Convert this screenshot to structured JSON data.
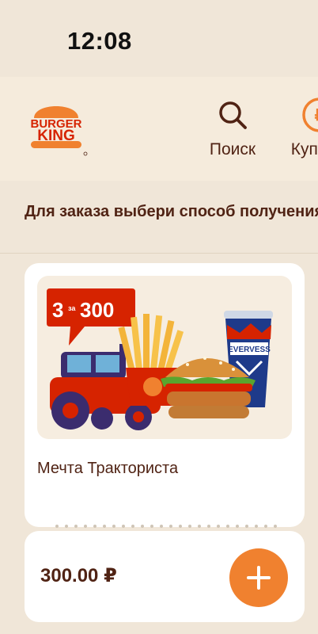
{
  "status_bar": {
    "time": "12:08"
  },
  "brand": {
    "logo_line1": "BURGER",
    "logo_line2": "KING",
    "accent_color": "#f0812f",
    "brand_red": "#d62300",
    "brown": "#502314"
  },
  "nav": [
    {
      "label": "Поиск",
      "icon": "search-icon"
    },
    {
      "label": "Купоны",
      "icon": "coupon-icon"
    }
  ],
  "instruction": "Для заказа выбери способ получения",
  "product": {
    "promo_badge": {
      "count": "3",
      "small": "за",
      "price": "300"
    },
    "drink_label": "EVERVESS",
    "title": "Мечта Тракториста",
    "price": "300.00 ₽"
  }
}
